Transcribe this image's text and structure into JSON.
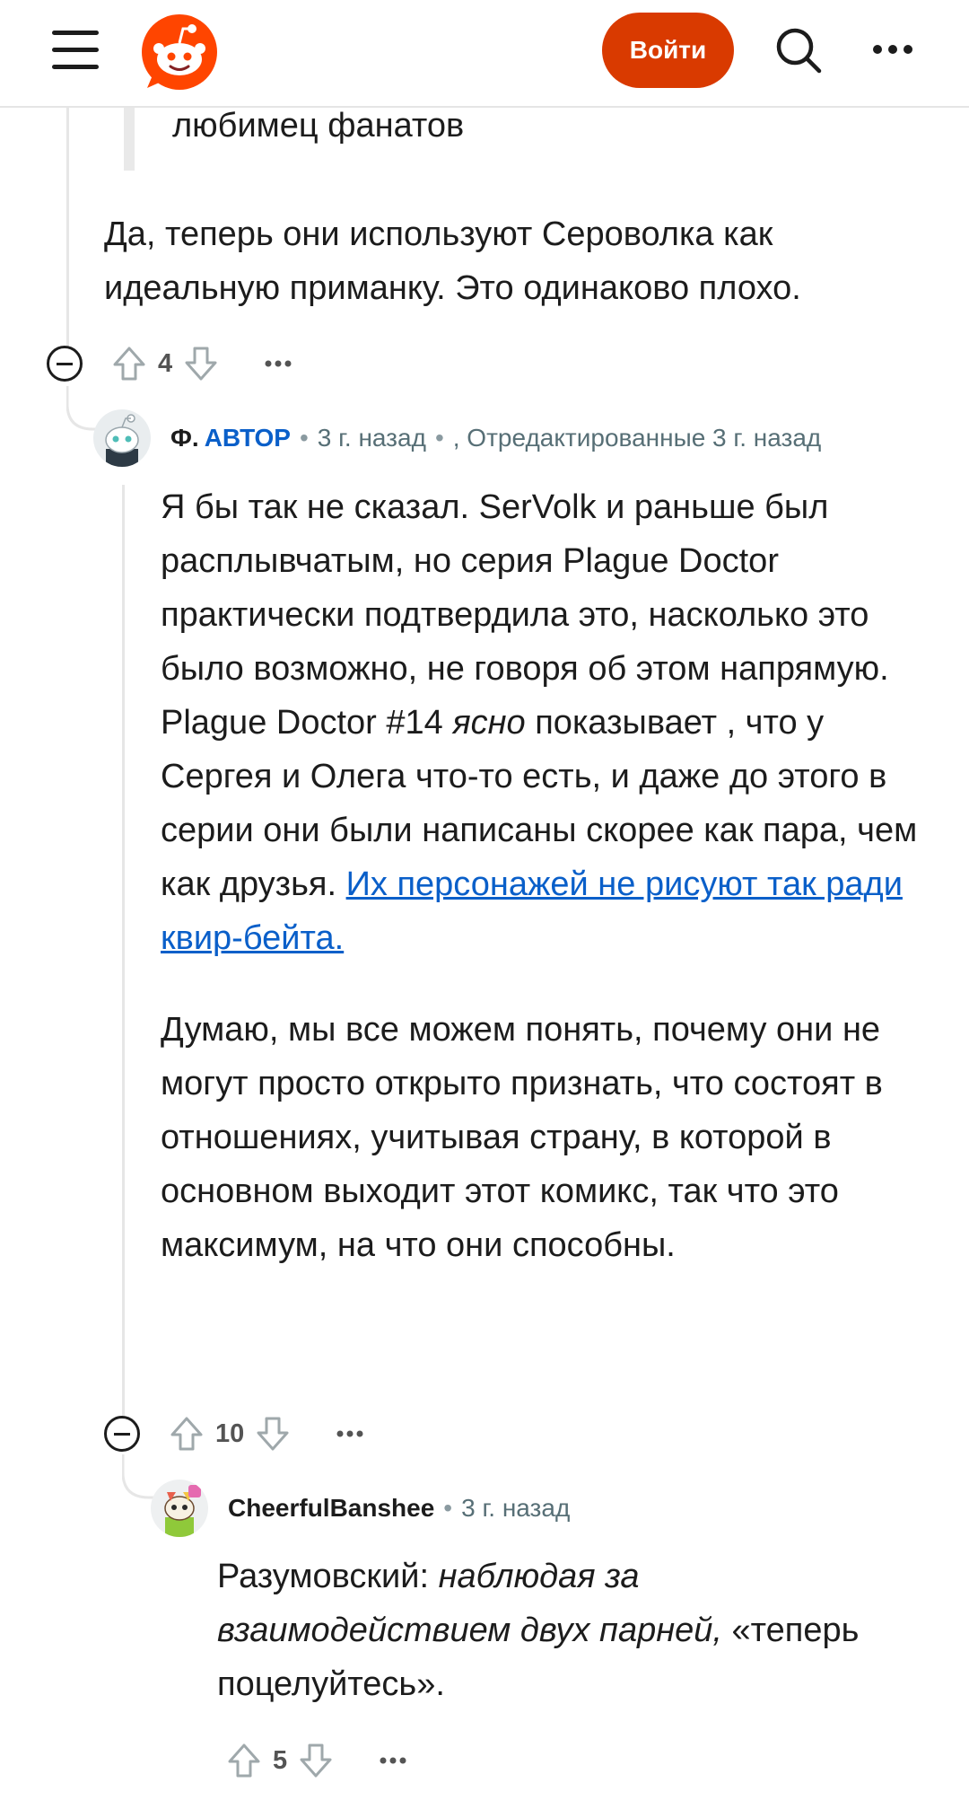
{
  "header": {
    "login_label": "Войти",
    "icons": [
      "menu-icon",
      "reddit-logo",
      "search-icon",
      "more-icon"
    ],
    "accent": "#d93a00"
  },
  "comment0": {
    "quote_tail": "любимец фанатов",
    "body": "Да, теперь они используют Сероволка как идеальную приманку. Это одинаково плохо.",
    "score": "4"
  },
  "comment1": {
    "author": "Ф.",
    "op_badge": "АВТОР",
    "time": "3 г. назад",
    "edited": ", Отредактированные 3 г. назад",
    "p1_a": "Я бы так не сказал. SerVolk и раньше был расплывчатым, но серия Plague Doctor практически подтвердила это, насколько это было возможно, не говоря об этом напрямую. Plague Doctor #14 ",
    "p1_em": "ясно",
    "p1_b": " показывает , что у Сергея и Олега что-то есть, и даже до этого в серии они были написаны скорее как пара, чем как друзья. ",
    "p1_link": "Их персонажей не рисуют так ради квир-бейта.",
    "p2": "Думаю, мы все можем понять, почему они не могут просто открыто признать, что состоят в отношениях, учитывая страну, в которой в основном выходит этот комикс, так что это максимум, на что они способны.",
    "score": "10"
  },
  "comment2": {
    "author": "CheerfulBanshee",
    "time": "3 г. назад",
    "body_a": "Разумовский: ",
    "body_em": "наблюдая за взаимодействием двух парней,",
    "body_b": " «теперь поцелуйтесь».",
    "score": "5"
  },
  "colors": {
    "link": "#0a5fc9",
    "text": "#1c1c1c",
    "meta": "#576f76"
  }
}
